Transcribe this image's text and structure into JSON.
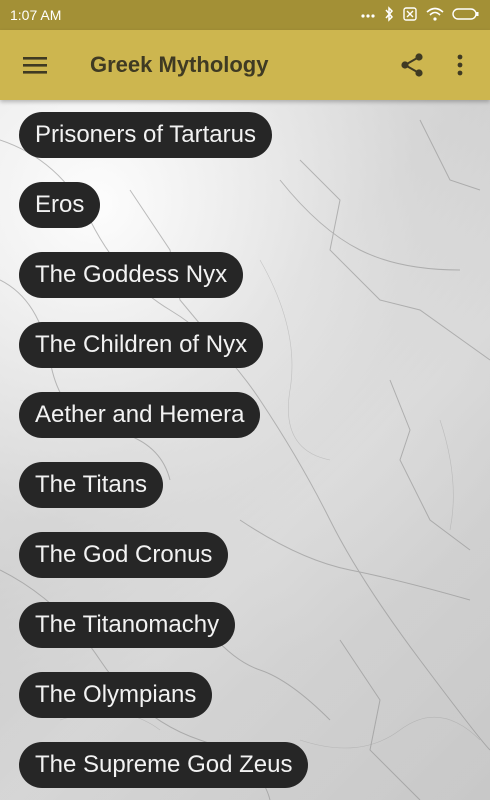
{
  "status_bar": {
    "time": "1:07 AM"
  },
  "app_bar": {
    "title": "Greek Mythology",
    "menu_icon": "hamburger-menu-icon",
    "share_icon": "share-icon",
    "overflow_icon": "more-vertical-icon"
  },
  "colors": {
    "status_bar": "#a39036",
    "app_bar": "#cdb64f",
    "chip": "#262626"
  },
  "items": [
    {
      "label": "Prisoners of Tartarus"
    },
    {
      "label": "Eros"
    },
    {
      "label": "The Goddess Nyx"
    },
    {
      "label": "The Children of Nyx"
    },
    {
      "label": "Aether and Hemera"
    },
    {
      "label": "The Titans"
    },
    {
      "label": "The God Cronus"
    },
    {
      "label": "The Titanomachy"
    },
    {
      "label": "The Olympians"
    },
    {
      "label": "The Supreme God Zeus"
    }
  ]
}
